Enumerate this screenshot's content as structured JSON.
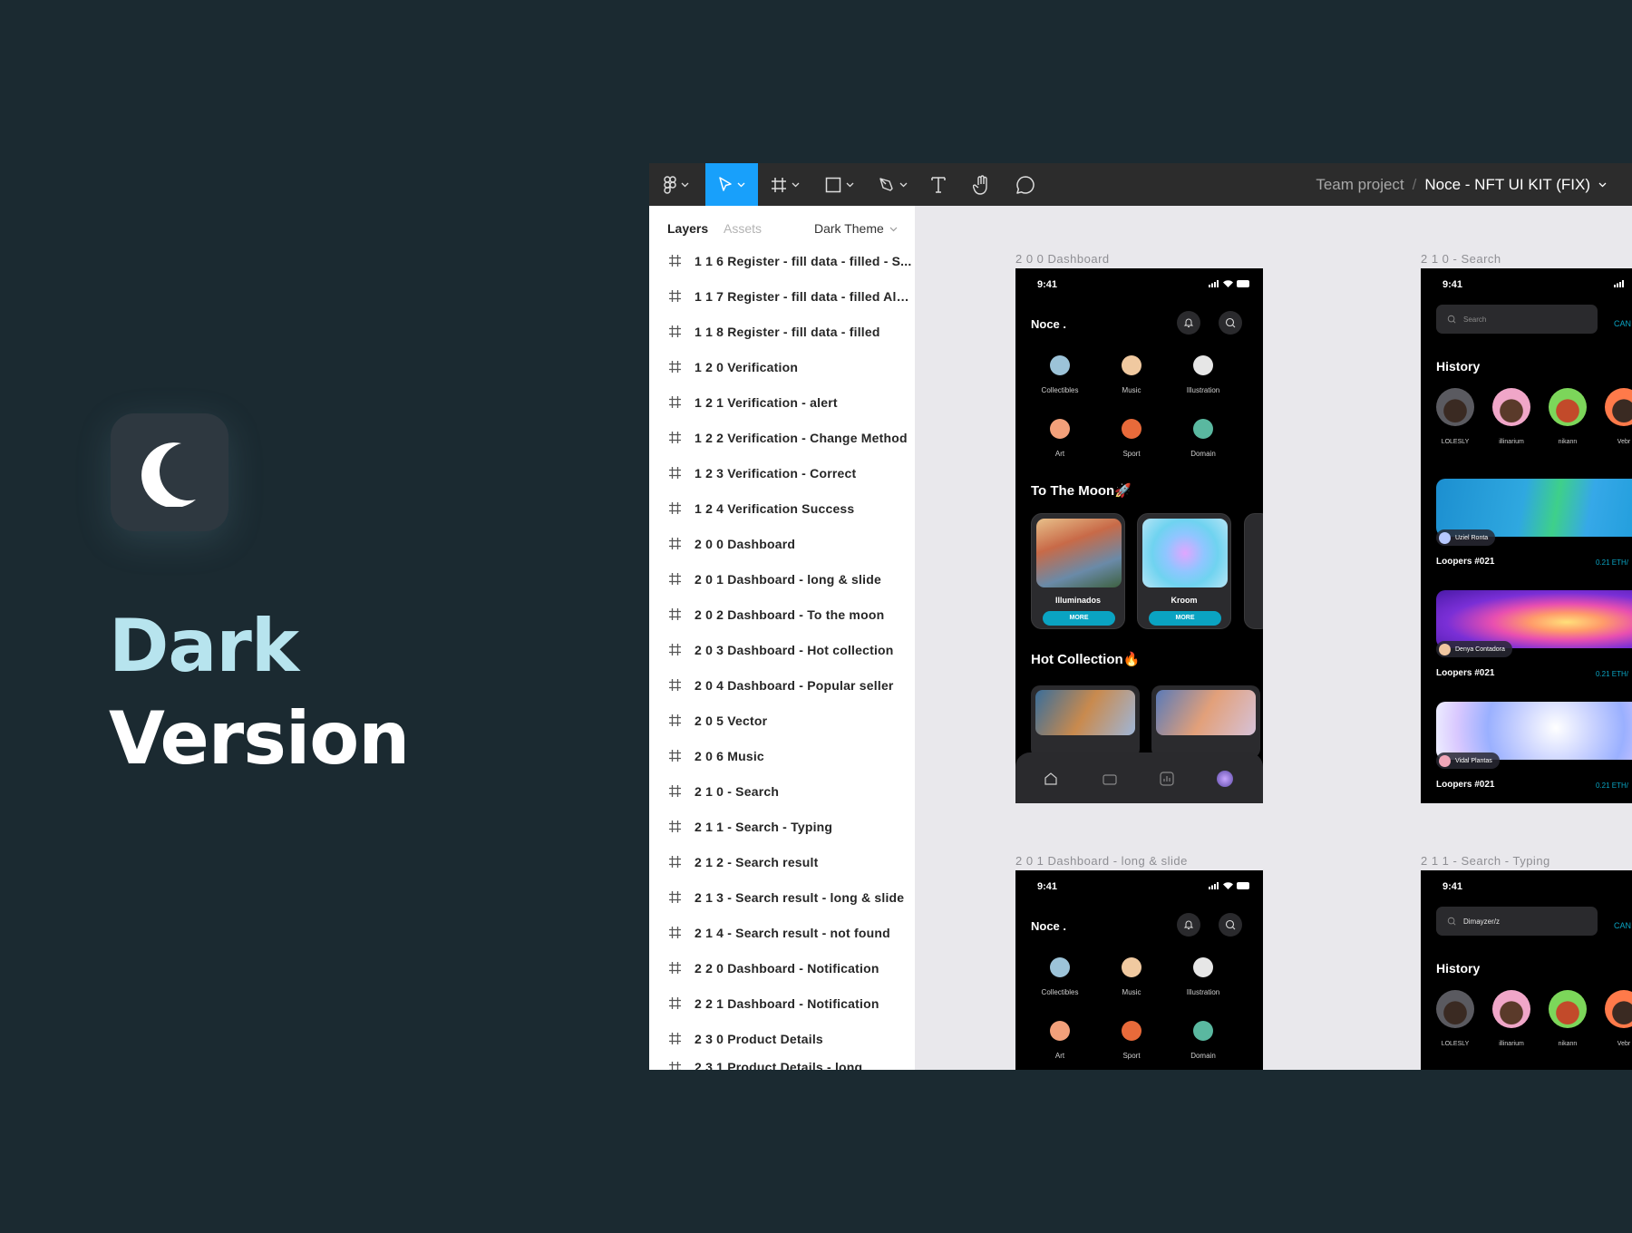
{
  "promo": {
    "line1": "Dark",
    "line2": "Version",
    "icon": "moon-icon",
    "accent": "#b7e4ee"
  },
  "toolbar": {
    "tools": [
      "figma-menu-icon",
      "move-tool-icon",
      "frame-tool-icon",
      "shape-tool-icon",
      "pen-tool-icon",
      "text-tool-icon",
      "hand-tool-icon",
      "comment-tool-icon"
    ],
    "active_tool": "move-tool-icon",
    "team": "Team project",
    "separator": "/",
    "file": "Noce - NFT UI KIT (FIX)"
  },
  "layers_panel": {
    "tab_layers": "Layers",
    "tab_assets": "Assets",
    "page": "Dark Theme",
    "items": [
      "1 1 6 Register - fill data - filled - S...",
      "1 1 7 Register - fill data - filled Alert",
      "1 1 8 Register - fill data - filled",
      "1 2 0 Verification",
      "1 2 1 Verification - alert",
      "1 2 2 Verification - Change Method",
      "1 2 3 Verification - Correct",
      "1 2 4 Verification Success",
      "2 0 0 Dashboard",
      "2 0 1 Dashboard - long & slide",
      "2 0 2 Dashboard - To the moon",
      "2 0 3 Dashboard - Hot collection",
      "2 0 4 Dashboard - Popular seller",
      "2 0 5 Vector",
      "2 0 6 Music",
      "2 1 0 - Search",
      "2 1 1 - Search - Typing",
      "2 1 2 - Search result",
      "2 1 3 - Search result - long & slide",
      "2 1 4 - Search result - not found",
      "2 2 0 Dashboard - Notification",
      "2 2 1 Dashboard - Notification",
      "2 3 0 Product Details",
      "2 3 1 Product Details - long"
    ]
  },
  "canvas": {
    "frames": {
      "dashboard": {
        "label": "2 0 0 Dashboard",
        "time": "9:41",
        "brand": "Noce .",
        "categories": [
          "Collectibles",
          "Music",
          "Illustration",
          "Art",
          "Sport",
          "Domain"
        ],
        "moon_title": "To The Moon🚀",
        "cards": [
          {
            "name": "Illuminados",
            "more": "MORE"
          },
          {
            "name": "Kroom",
            "more": "MORE"
          }
        ],
        "hot_title": "Hot Collection🔥"
      },
      "search": {
        "label": "2 1 0 - Search",
        "time": "9:41",
        "placeholder": "Search",
        "cancel": "CAN",
        "history": "History",
        "people": [
          "LOLESLY",
          "illinarium",
          "nikann",
          "Vebr"
        ],
        "items": [
          {
            "owner": "Uziel Ronta",
            "title": "Loopers #021",
            "price": "0.21 ETH/"
          },
          {
            "owner": "Denya Contadora",
            "title": "Loopers #021",
            "price": "0.21 ETH/"
          },
          {
            "owner": "Vidal Plantas",
            "title": "Loopers #021",
            "price": "0.21 ETH/"
          }
        ]
      },
      "dashboard_long": {
        "label": "2 0 1 Dashboard - long & slide",
        "time": "9:41",
        "brand": "Noce .",
        "categories": [
          "Collectibles",
          "Music",
          "Illustration",
          "Art",
          "Sport",
          "Domain"
        ]
      },
      "search_typing": {
        "label": "2 1 1 - Search - Typing",
        "time": "9:41",
        "query": "Dimayzer/z",
        "cancel": "CAN",
        "history": "History",
        "people": [
          "LOLESLY",
          "illinarium",
          "nikann",
          "Vebr"
        ]
      }
    }
  },
  "colors": {
    "background": "#1b2a31",
    "toolbar": "#2c2c2c",
    "active_tool": "#18a0fb",
    "canvas": "#e9e8ec",
    "accent": "#0aa3c2"
  }
}
